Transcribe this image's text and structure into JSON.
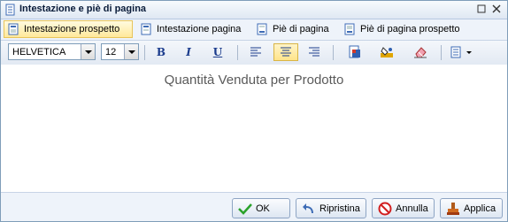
{
  "window": {
    "title": "Intestazione e piè di pagina"
  },
  "tabs": [
    {
      "label": "Intestazione prospetto",
      "active": true
    },
    {
      "label": "Intestazione pagina",
      "active": false
    },
    {
      "label": "Piè di pagina",
      "active": false
    },
    {
      "label": "Piè di pagina prospetto",
      "active": false
    }
  ],
  "toolbar": {
    "font": "HELVETICA",
    "size": "12",
    "bold_label": "B",
    "italic_label": "I",
    "underline_label": "U",
    "alignment_selected": "center"
  },
  "editor": {
    "text": "Quantità Venduta per Prodotto"
  },
  "buttons": {
    "ok": "OK",
    "reset": "Ripristina",
    "cancel": "Annulla",
    "apply": "Applica"
  },
  "colors": {
    "accent_tab": "#ffe89a",
    "border": "#7f9db9"
  }
}
